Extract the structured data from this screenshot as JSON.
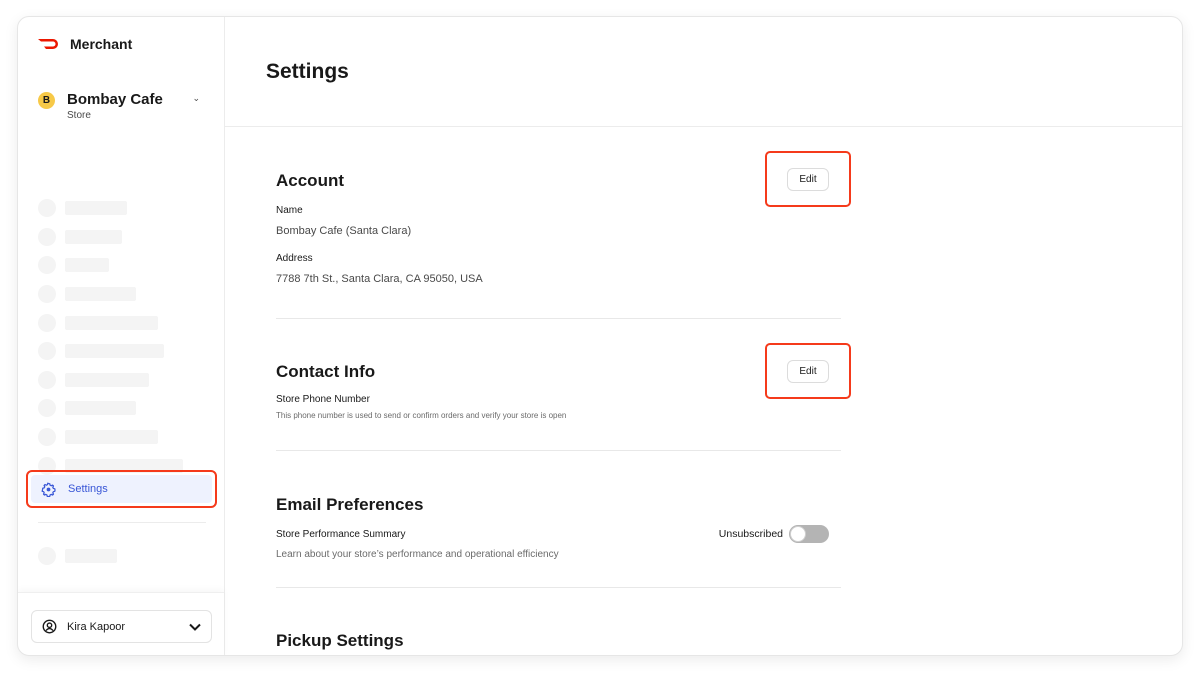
{
  "brand": {
    "name": "Merchant",
    "logo_color": "#eb1700"
  },
  "store": {
    "initial": "B",
    "name": "Bombay Cafe",
    "type": "Store",
    "avatar_color": "#f7c948"
  },
  "sidebar": {
    "skeleton_items": 10,
    "active_item": {
      "label": "Settings",
      "icon": "gear-icon",
      "color": "#3856d6"
    }
  },
  "user": {
    "name": "Kira Kapoor"
  },
  "page": {
    "title": "Settings"
  },
  "sections": {
    "account": {
      "title": "Account",
      "edit_label": "Edit",
      "name_label": "Name",
      "name_value": "Bombay Cafe (Santa Clara)",
      "address_label": "Address",
      "address_value": "7788 7th St., Santa Clara, CA 95050, USA"
    },
    "contact": {
      "title": "Contact Info",
      "edit_label": "Edit",
      "phone_label": "Store Phone Number",
      "phone_hint": "This phone number is used to send or confirm orders and verify your store is open"
    },
    "email": {
      "title": "Email Preferences",
      "summary_label": "Store Performance Summary",
      "summary_hint": "Learn about your store’s performance and operational efficiency",
      "status": "Unsubscribed",
      "subscribed": false
    },
    "pickup": {
      "title": "Pickup Settings"
    }
  },
  "highlight_color": "#f53a1b"
}
